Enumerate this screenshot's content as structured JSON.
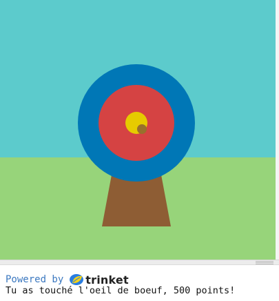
{
  "scene": {
    "colors": {
      "sky": "#5ccbcc",
      "grass": "#97d47a",
      "stand": "#8e5d34",
      "outer_ring": "#0077b6",
      "middle_ring": "#d54343",
      "bullseye": "#e6cb00",
      "arrow": "#98702c"
    }
  },
  "footer": {
    "powered_by": "Powered by",
    "brand": "trinket",
    "logo_icon": "trinket-leaf-logo-icon"
  },
  "console": {
    "message": "Tu as touché l'oeil de boeuf, 500 points!"
  }
}
